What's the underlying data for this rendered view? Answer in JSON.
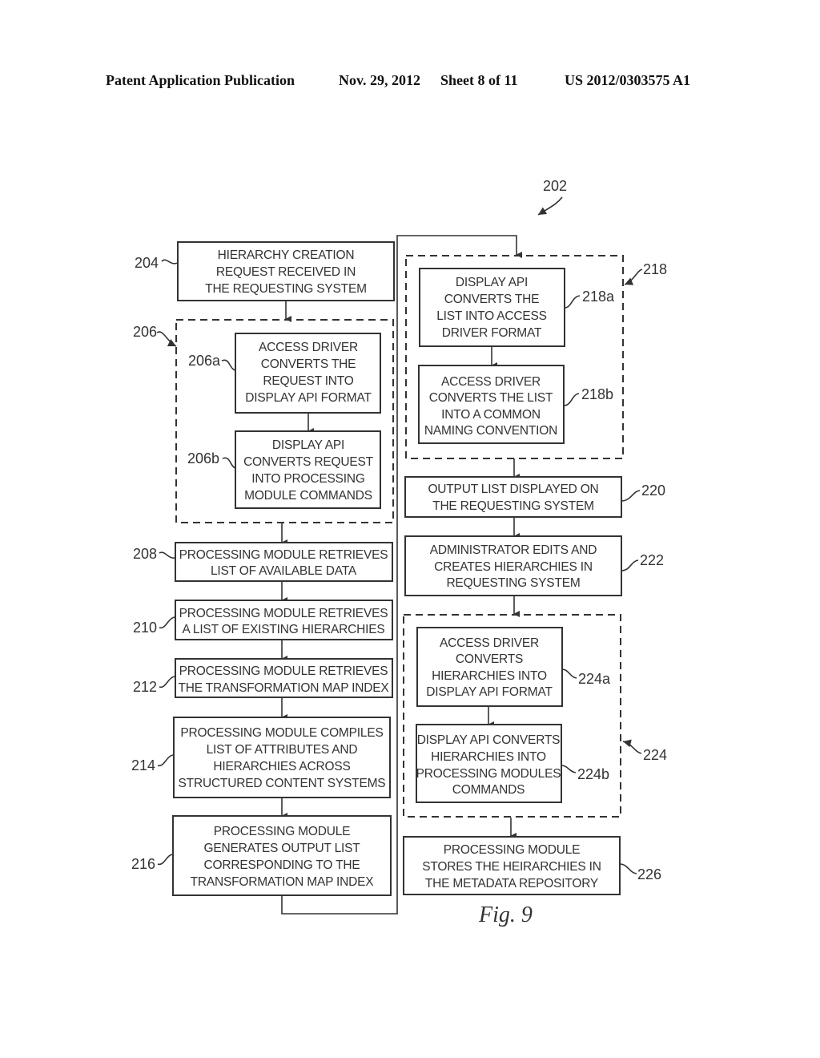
{
  "header": {
    "publication": "Patent Application Publication",
    "date": "Nov. 29, 2012",
    "sheet": "Sheet 8 of 11",
    "number": "US 2012/0303575 A1"
  },
  "figure": {
    "ref": "202",
    "caption": "Fig. 9",
    "nodes": {
      "n204": {
        "ref": "204",
        "lines": [
          "HIERARCHY CREATION",
          "REQUEST RECEIVED IN",
          "THE REQUESTING SYSTEM"
        ]
      },
      "n206": {
        "ref": "206"
      },
      "n206a": {
        "ref": "206a",
        "lines": [
          "ACCESS DRIVER",
          "CONVERTS THE",
          "REQUEST INTO",
          "DISPLAY API FORMAT"
        ]
      },
      "n206b": {
        "ref": "206b",
        "lines": [
          "DISPLAY API",
          "CONVERTS REQUEST",
          "INTO PROCESSING",
          "MODULE COMMANDS"
        ]
      },
      "n208": {
        "ref": "208",
        "lines": [
          "PROCESSING MODULE RETRIEVES",
          "LIST OF AVAILABLE DATA"
        ]
      },
      "n210": {
        "ref": "210",
        "lines": [
          "PROCESSING MODULE RETRIEVES",
          "A LIST OF EXISTING HIERARCHIES"
        ]
      },
      "n212": {
        "ref": "212",
        "lines": [
          "PROCESSING MODULE RETRIEVES",
          "THE TRANSFORMATION MAP INDEX"
        ]
      },
      "n214": {
        "ref": "214",
        "lines": [
          "PROCESSING MODULE COMPILES",
          "LIST OF ATTRIBUTES AND",
          "HIERARCHIES ACROSS",
          "STRUCTURED CONTENT SYSTEMS"
        ]
      },
      "n216": {
        "ref": "216",
        "lines": [
          "PROCESSING MODULE",
          "GENERATES OUTPUT LIST",
          "CORRESPONDING TO THE",
          "TRANSFORMATION MAP INDEX"
        ]
      },
      "n218": {
        "ref": "218"
      },
      "n218a": {
        "ref": "218a",
        "lines": [
          "DISPLAY API",
          "CONVERTS THE",
          "LIST INTO ACCESS",
          "DRIVER FORMAT"
        ]
      },
      "n218b": {
        "ref": "218b",
        "lines": [
          "ACCESS DRIVER",
          "CONVERTS THE LIST",
          "INTO A COMMON",
          "NAMING CONVENTION"
        ]
      },
      "n220": {
        "ref": "220",
        "lines": [
          "OUTPUT LIST DISPLAYED ON",
          "THE REQUESTING SYSTEM"
        ]
      },
      "n222": {
        "ref": "222",
        "lines": [
          "ADMINISTRATOR EDITS AND",
          "CREATES HIERARCHIES IN",
          "REQUESTING SYSTEM"
        ]
      },
      "n224": {
        "ref": "224"
      },
      "n224a": {
        "ref": "224a",
        "lines": [
          "ACCESS DRIVER",
          "CONVERTS",
          "HIERARCHIES INTO",
          "DISPLAY API FORMAT"
        ]
      },
      "n224b": {
        "ref": "224b",
        "lines": [
          "DISPLAY API CONVERTS",
          "HIERARCHIES INTO",
          "PROCESSING MODULES",
          "COMMANDS"
        ]
      },
      "n226": {
        "ref": "226",
        "lines": [
          "PROCESSING MODULE",
          "STORES THE HEIRARCHIES IN",
          "THE METADATA REPOSITORY"
        ]
      }
    }
  }
}
